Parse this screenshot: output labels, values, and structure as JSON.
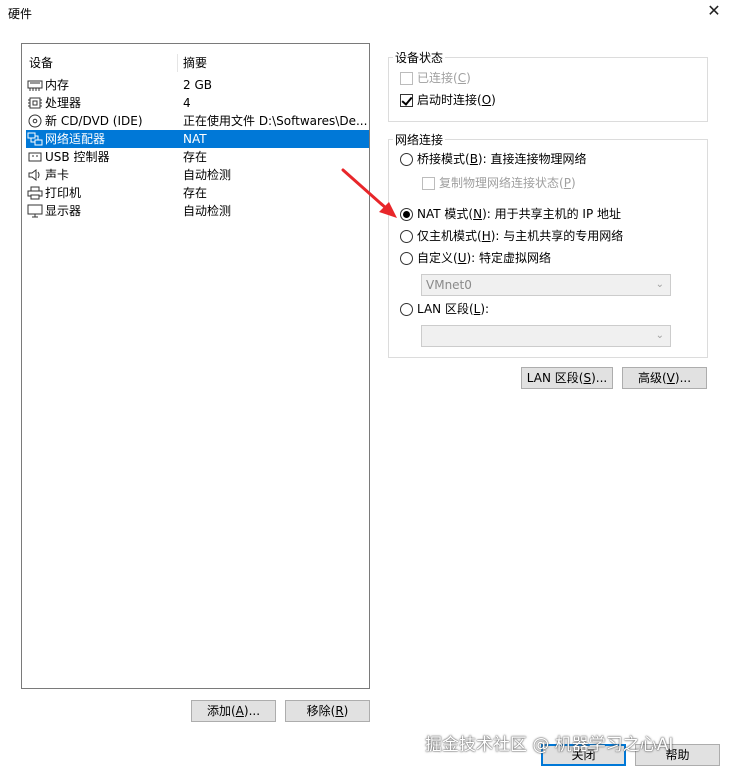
{
  "window": {
    "title": "硬件"
  },
  "device_list": {
    "col_device": "设备",
    "col_summary": "摘要",
    "rows": [
      {
        "name": "内存",
        "summary": "2 GB",
        "icon": "memory-icon"
      },
      {
        "name": "处理器",
        "summary": "4",
        "icon": "cpu-icon"
      },
      {
        "name": "新 CD/DVD (IDE)",
        "summary": "正在使用文件 D:\\Softwares\\De...",
        "icon": "cd-icon"
      },
      {
        "name": "网络适配器",
        "summary": "NAT",
        "icon": "network-icon",
        "selected": true
      },
      {
        "name": "USB 控制器",
        "summary": "存在",
        "icon": "usb-icon"
      },
      {
        "name": "声卡",
        "summary": "自动检测",
        "icon": "speaker-icon"
      },
      {
        "name": "打印机",
        "summary": "存在",
        "icon": "printer-icon"
      },
      {
        "name": "显示器",
        "summary": "自动检测",
        "icon": "monitor-icon"
      }
    ],
    "add_label": "添加(",
    "add_key": "A",
    "add_suffix": ")...",
    "remove_label": "移除(",
    "remove_key": "R",
    "remove_suffix": ")"
  },
  "device_status": {
    "title": "设备状态",
    "connected_label": "已连接(",
    "connected_key": "C",
    "connected_suffix": ")",
    "connected": false,
    "connect_on_start_label": "启动时连接(",
    "connect_on_start_key": "O",
    "connect_on_start_suffix": ")",
    "connect_on_start": true
  },
  "network": {
    "title": "网络连接",
    "bridged_label": "桥接模式(",
    "bridged_key": "B",
    "bridged_suffix": "): 直接连接物理网络",
    "replicate_label": "复制物理网络连接状态(",
    "replicate_key": "P",
    "replicate_suffix": ")",
    "nat_label": "NAT 模式(",
    "nat_key": "N",
    "nat_suffix": "): 用于共享主机的 IP 地址",
    "hostonly_label": "仅主机模式(",
    "hostonly_key": "H",
    "hostonly_suffix": "): 与主机共享的专用网络",
    "custom_label": "自定义(",
    "custom_key": "U",
    "custom_suffix": "): 特定虚拟网络",
    "custom_select_value": "VMnet0",
    "lan_label": "LAN 区段(",
    "lan_key": "L",
    "lan_suffix": "):",
    "lan_select_value": "",
    "selected_mode": "nat"
  },
  "buttons": {
    "lan_segments_label": "LAN 区段(",
    "lan_segments_key": "S",
    "lan_segments_suffix": ")...",
    "advanced_label": "高级(",
    "advanced_key": "V",
    "advanced_suffix": ")...",
    "close_label": "关闭",
    "help_label": "帮助"
  },
  "watermark": "掘金技术社区 @ 机器学习之心AI",
  "colors": {
    "selection": "#0078d7",
    "annotation_arrow": "#e8262a"
  }
}
